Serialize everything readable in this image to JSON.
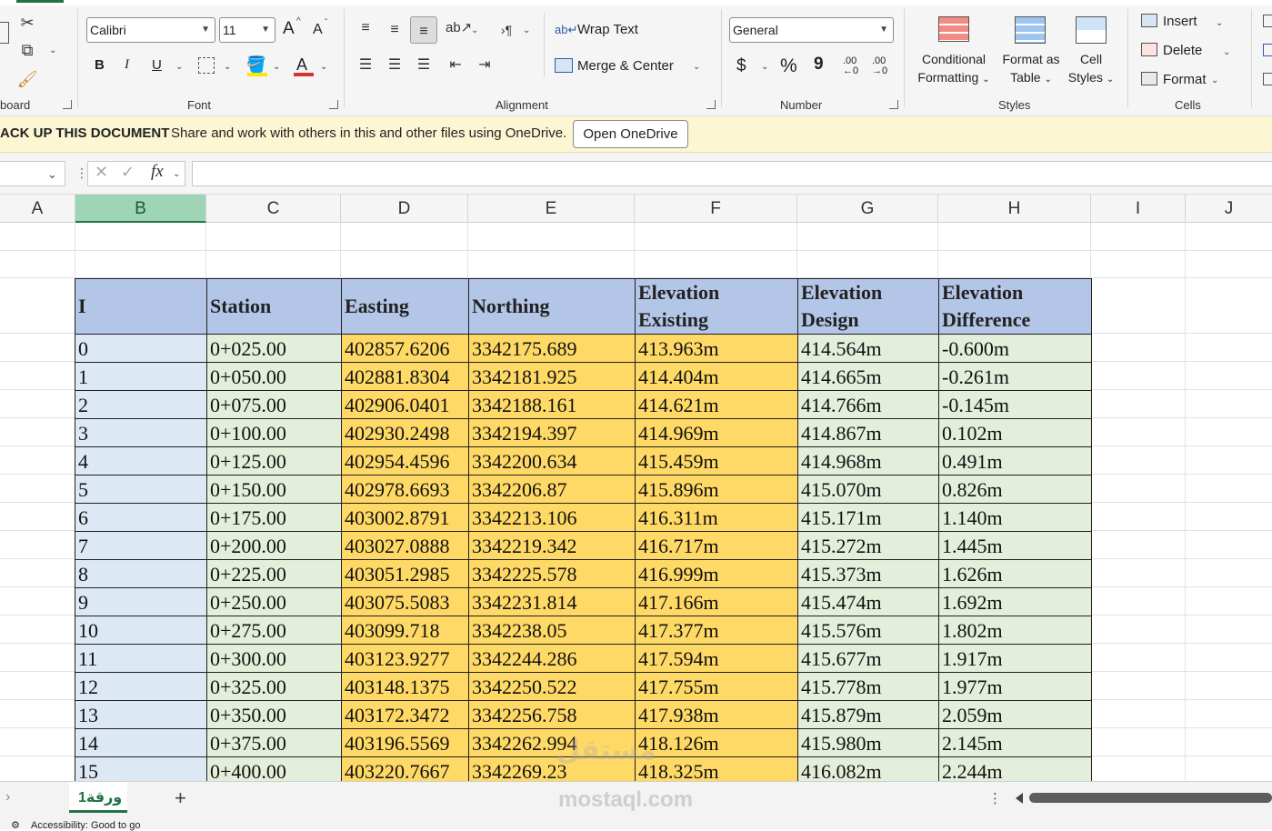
{
  "ribbon": {
    "clipboard": {
      "label": "board"
    },
    "font": {
      "label": "Font",
      "font_name": "Calibri",
      "font_size": "11",
      "grow_label": "A",
      "shrink_label": "A",
      "bold": "B",
      "italic": "I",
      "underline": "U",
      "font_color_letter": "A"
    },
    "alignment": {
      "label": "Alignment",
      "wrap_text": "Wrap Text",
      "merge_center": "Merge & Center"
    },
    "number": {
      "label": "Number",
      "format": "General",
      "currency": "$",
      "percent": "%",
      "comma": "9",
      "inc_decimal": ".00",
      "dec_decimal": ".00"
    },
    "styles": {
      "label": "Styles",
      "conditional_1": "Conditional",
      "conditional_2": "Formatting",
      "format_table_1": "Format as",
      "format_table_2": "Table",
      "cell_styles_1": "Cell",
      "cell_styles_2": "Styles"
    },
    "cells": {
      "label": "Cells",
      "insert": "Insert",
      "delete": "Delete",
      "format": "Format"
    }
  },
  "message_bar": {
    "title": "ACK UP THIS DOCUMENT",
    "text": "Share and work with others in this and other files using OneDrive.",
    "button": "Open OneDrive"
  },
  "formula_bar": {
    "fx": "fx"
  },
  "columns": [
    "A",
    "B",
    "C",
    "D",
    "E",
    "F",
    "G",
    "H",
    "I",
    "J"
  ],
  "table": {
    "headers": [
      {
        "line1": "I",
        "line2": ""
      },
      {
        "line1": "Station",
        "line2": ""
      },
      {
        "line1": "Easting",
        "line2": ""
      },
      {
        "line1": "Northing",
        "line2": ""
      },
      {
        "line1": "Elevation",
        "line2": "Existing"
      },
      {
        "line1": "Elevation",
        "line2": "Design"
      },
      {
        "line1": "Elevation",
        "line2": "Difference"
      }
    ],
    "rows": [
      [
        "0",
        "0+025.00",
        "402857.6206",
        "3342175.689",
        "413.963m",
        "414.564m",
        "-0.600m"
      ],
      [
        "1",
        "0+050.00",
        "402881.8304",
        "3342181.925",
        "414.404m",
        "414.665m",
        "-0.261m"
      ],
      [
        "2",
        "0+075.00",
        "402906.0401",
        "3342188.161",
        "414.621m",
        "414.766m",
        "-0.145m"
      ],
      [
        "3",
        "0+100.00",
        "402930.2498",
        "3342194.397",
        "414.969m",
        "414.867m",
        "0.102m"
      ],
      [
        "4",
        "0+125.00",
        "402954.4596",
        "3342200.634",
        "415.459m",
        "414.968m",
        "0.491m"
      ],
      [
        "5",
        "0+150.00",
        "402978.6693",
        "3342206.87",
        "415.896m",
        "415.070m",
        "0.826m"
      ],
      [
        "6",
        "0+175.00",
        "403002.8791",
        "3342213.106",
        "416.311m",
        "415.171m",
        "1.140m"
      ],
      [
        "7",
        "0+200.00",
        "403027.0888",
        "3342219.342",
        "416.717m",
        "415.272m",
        "1.445m"
      ],
      [
        "8",
        "0+225.00",
        "403051.2985",
        "3342225.578",
        "416.999m",
        "415.373m",
        "1.626m"
      ],
      [
        "9",
        "0+250.00",
        "403075.5083",
        "3342231.814",
        "417.166m",
        "415.474m",
        "1.692m"
      ],
      [
        "10",
        "0+275.00",
        "403099.718",
        "3342238.05",
        "417.377m",
        "415.576m",
        "1.802m"
      ],
      [
        "11",
        "0+300.00",
        "403123.9277",
        "3342244.286",
        "417.594m",
        "415.677m",
        "1.917m"
      ],
      [
        "12",
        "0+325.00",
        "403148.1375",
        "3342250.522",
        "417.755m",
        "415.778m",
        "1.977m"
      ],
      [
        "13",
        "0+350.00",
        "403172.3472",
        "3342256.758",
        "417.938m",
        "415.879m",
        "2.059m"
      ],
      [
        "14",
        "0+375.00",
        "403196.5569",
        "3342262.994",
        "418.126m",
        "415.980m",
        "2.145m"
      ],
      [
        "15",
        "0+400.00",
        "403220.7667",
        "3342269.23",
        "418.325m",
        "416.082m",
        "2.244m"
      ]
    ]
  },
  "sheet_tabs": {
    "active": "ورقة1",
    "add": "+"
  },
  "status_bar": {
    "text": "Accessibility: Good to go"
  },
  "watermark": {
    "arabic": "مستقل",
    "latin": "mostaql.com"
  },
  "colors": {
    "accent": "#217346",
    "header_fill": "#b4c6e7",
    "yellow_fill": "#ffd966",
    "green_fill": "#e3efda",
    "blue_fill": "#dde8f5"
  }
}
